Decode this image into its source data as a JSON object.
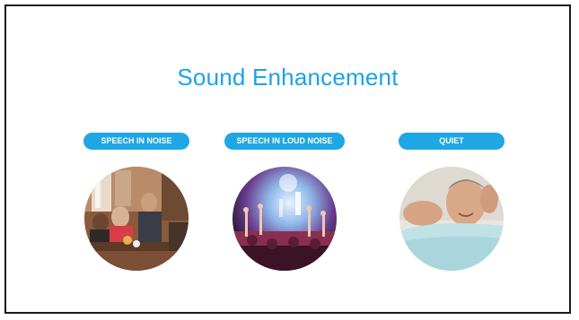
{
  "slide": {
    "title": "Sound Enhancement",
    "scenarios": [
      {
        "label": "SPEECH IN NOISE",
        "image": "restaurant-crowd-photo"
      },
      {
        "label": "SPEECH IN LOUD NOISE",
        "image": "concert-crowd-photo"
      },
      {
        "label": "QUIET",
        "image": "relaxing-man-photo"
      }
    ]
  }
}
